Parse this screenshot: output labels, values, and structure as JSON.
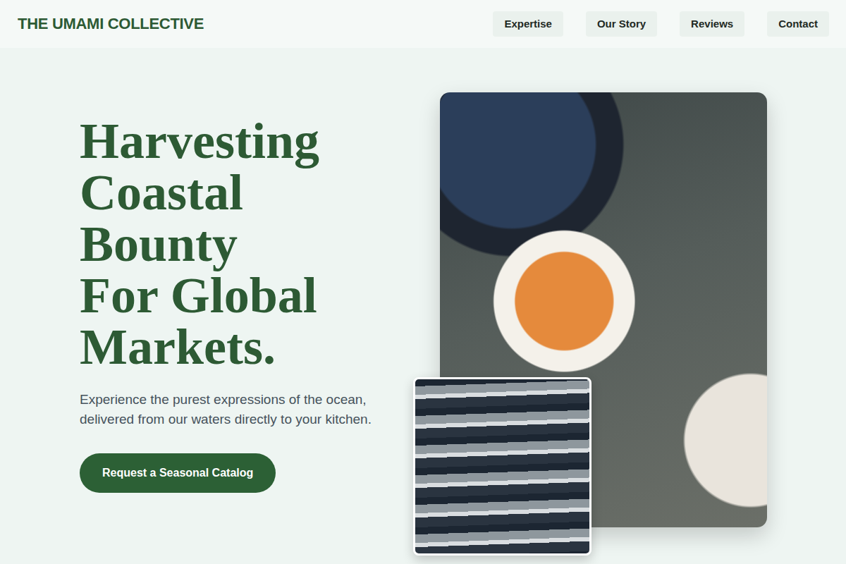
{
  "header": {
    "logo": "THE UMAMI COLLECTIVE",
    "nav": [
      {
        "label": "Expertise"
      },
      {
        "label": "Our Story"
      },
      {
        "label": "Reviews"
      },
      {
        "label": "Contact"
      }
    ]
  },
  "hero": {
    "heading": [
      "Harvesting",
      "Coastal",
      "Bounty",
      "For Global",
      "Markets."
    ],
    "subtitle": "Experience the purest expressions of the ocean, delivered from our waters directly to your kitchen.",
    "cta": "Request a Seasonal Catalog"
  }
}
